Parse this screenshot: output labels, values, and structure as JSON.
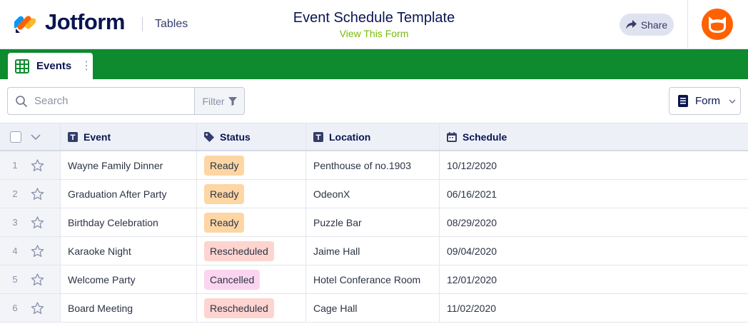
{
  "header": {
    "brand": "Jotform",
    "section": "Tables",
    "form_title": "Event Schedule Template",
    "view_form_link": "View This Form",
    "share_label": "Share"
  },
  "tabs": [
    {
      "label": "Events",
      "icon": "table-grid-icon"
    }
  ],
  "toolbar": {
    "search_placeholder": "Search",
    "filter_label": "Filter",
    "form_label": "Form"
  },
  "table": {
    "columns": [
      {
        "label": "Event",
        "icon": "text-type-icon"
      },
      {
        "label": "Status",
        "icon": "tag-icon"
      },
      {
        "label": "Location",
        "icon": "text-type-icon"
      },
      {
        "label": "Schedule",
        "icon": "calendar-icon"
      }
    ],
    "rows": [
      {
        "num": "1",
        "event": "Wayne Family Dinner",
        "status": "Ready",
        "status_kind": "ready",
        "location": "Penthouse of no.1903",
        "schedule": "10/12/2020"
      },
      {
        "num": "2",
        "event": "Graduation After Party",
        "status": "Ready",
        "status_kind": "ready",
        "location": "OdeonX",
        "schedule": "06/16/2021"
      },
      {
        "num": "3",
        "event": "Birthday Celebration",
        "status": "Ready",
        "status_kind": "ready",
        "location": "Puzzle Bar",
        "schedule": "08/29/2020"
      },
      {
        "num": "4",
        "event": "Karaoke Night",
        "status": "Rescheduled",
        "status_kind": "resched",
        "location": "Jaime Hall",
        "schedule": "09/04/2020"
      },
      {
        "num": "5",
        "event": "Welcome Party",
        "status": "Cancelled",
        "status_kind": "cancel",
        "location": "Hotel Conferance Room",
        "schedule": "12/01/2020"
      },
      {
        "num": "6",
        "event": "Board Meeting",
        "status": "Rescheduled",
        "status_kind": "resched",
        "location": "Cage Hall",
        "schedule": "11/02/2020"
      }
    ]
  },
  "colors": {
    "brand_navy": "#0a1551",
    "tab_band_green": "#0d8b2e",
    "view_link_green": "#78bb07",
    "avatar_orange": "#ff6100",
    "status_ready": "#fdd6a4",
    "status_rescheduled": "#fdd4cf",
    "status_cancelled": "#fbd5f0"
  }
}
